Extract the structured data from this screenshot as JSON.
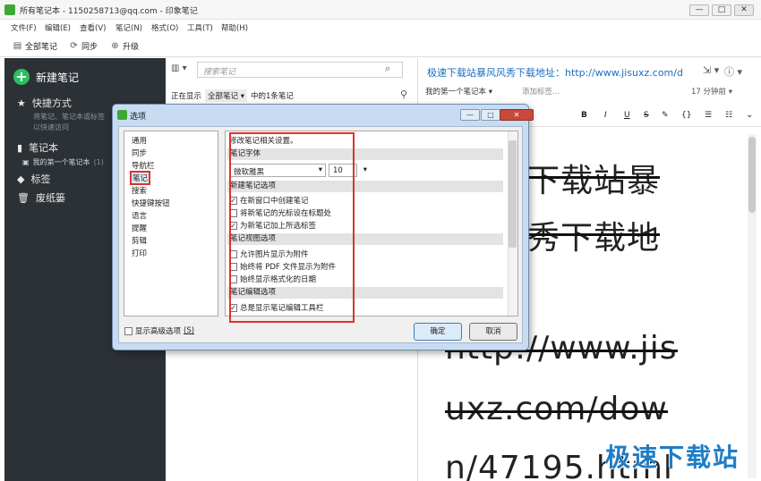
{
  "window": {
    "title": "所有笔记本 - 1150258713@qq.com - 印象笔记",
    "controls": [
      "—",
      "□",
      "✕"
    ]
  },
  "menu": [
    "文件(F)",
    "编辑(E)",
    "查看(V)",
    "笔记(N)",
    "格式(O)",
    "工具(T)",
    "帮助(H)"
  ],
  "toolbar": {
    "all_notes": "全部笔记",
    "sync": "同步",
    "upgrade": "升级"
  },
  "sidebar": {
    "new_note": "新建笔记",
    "shortcuts": "快捷方式",
    "shortcuts_hint_1": "将笔记、笔记本或标签",
    "shortcuts_hint_2": "以快速访问",
    "notebooks": "笔记本",
    "my_notebook": "我的第一个笔记本",
    "my_notebook_count": "(1)",
    "tags": "标签",
    "trash": "废纸篓"
  },
  "notelist": {
    "search_placeholder": "搜索笔记",
    "showing_prefix": "正在显示",
    "filter": "全部笔记 ▾",
    "count_text": "中的1条笔记"
  },
  "editor": {
    "title": "极速下载站暴风风秀下载地址：http://www.jisuxz.com/d",
    "notebook": "我的第一个笔记本 ▾",
    "add_tag": "添加标签...",
    "time": "17 分钟前 ▾",
    "lines": [
      "下载站暴",
      "秀下载地",
      "http://www.jis",
      "uxz.com/dow",
      "n/47195.html"
    ]
  },
  "watermark": "极速下载站",
  "dialog": {
    "title": "选项",
    "categories": [
      "通用",
      "同步",
      "导航栏",
      "笔记",
      "搜索",
      "快捷键按钮",
      "语言",
      "提醒",
      "剪辑",
      "打印"
    ],
    "selected_category": "笔记",
    "intro": "修改笔记相关设置。",
    "font_section": "笔记字体",
    "font_value": "微软雅黑",
    "size_value": "10",
    "new_note_section": "新建笔记选项",
    "new_note_options": [
      {
        "label": "在新窗口中创建笔记",
        "checked": true
      },
      {
        "label": "将新笔记的光标设在标题处",
        "checked": false
      },
      {
        "label": "为新笔记加上所选标签",
        "checked": true
      }
    ],
    "view_section": "笔记视图选项",
    "view_options": [
      {
        "label": "允许图片显示为附件",
        "checked": false
      },
      {
        "label": "始终将 PDF 文件显示为附件",
        "checked": false
      },
      {
        "label": "始终显示格式化的日期",
        "checked": false
      }
    ],
    "edit_section": "笔记编辑选项",
    "edit_options": [
      {
        "label": "总是显示笔记编辑工具栏",
        "checked": true
      }
    ],
    "advanced_label": "显示高级选项",
    "advanced_shortcut": "(S)",
    "ok": "确定",
    "cancel": "取消"
  },
  "colors": {
    "sidebar_bg": "#2c3136",
    "accent_green": "#2dbe60",
    "link_blue": "#1a6fc2",
    "highlight_red": "#e03030"
  }
}
